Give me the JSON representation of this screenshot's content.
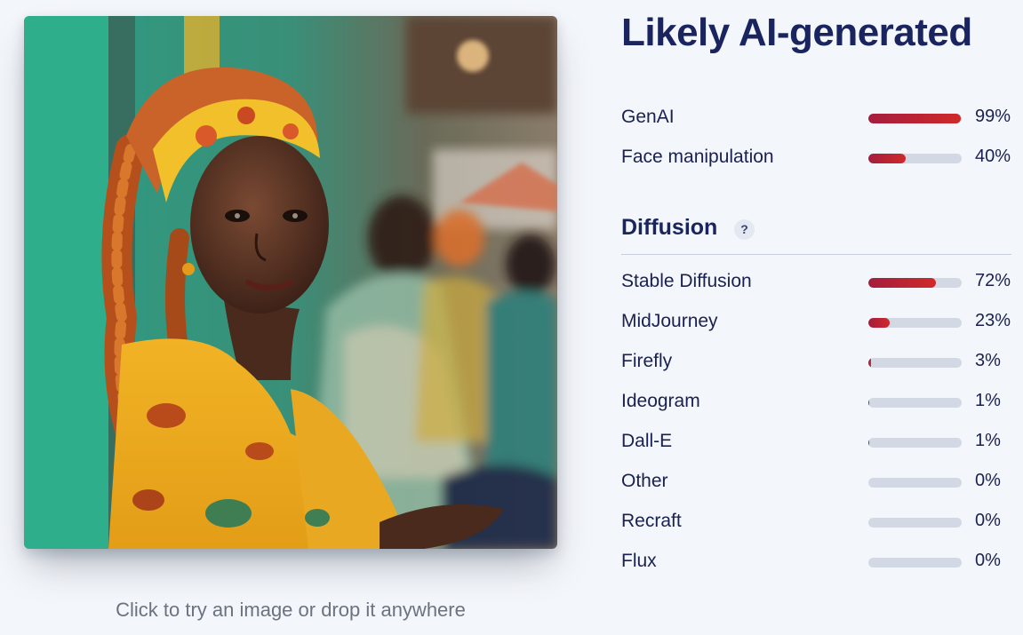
{
  "verdict": {
    "title": "Likely AI-generated"
  },
  "image": {
    "caption": "Click to try an image or drop it anywhere"
  },
  "colors": {
    "bar_fill_start": "#a51d3e",
    "bar_fill_end": "#cf2a2a",
    "bar_track": "#d3d9e4",
    "title": "#1a2560"
  },
  "summary": {
    "rows": [
      {
        "label": "GenAI",
        "value": 99,
        "percent": "99%"
      },
      {
        "label": "Face manipulation",
        "value": 40,
        "percent": "40%"
      }
    ]
  },
  "diffusion": {
    "title": "Diffusion",
    "help_label": "?",
    "rows": [
      {
        "label": "Stable Diffusion",
        "value": 72,
        "percent": "72%"
      },
      {
        "label": "MidJourney",
        "value": 23,
        "percent": "23%"
      },
      {
        "label": "Firefly",
        "value": 3,
        "percent": "3%"
      },
      {
        "label": "Ideogram",
        "value": 1,
        "percent": "1%"
      },
      {
        "label": "Dall-E",
        "value": 1,
        "percent": "1%"
      },
      {
        "label": "Other",
        "value": 0,
        "percent": "0%"
      },
      {
        "label": "Recraft",
        "value": 0,
        "percent": "0%"
      },
      {
        "label": "Flux",
        "value": 0,
        "percent": "0%"
      }
    ]
  }
}
